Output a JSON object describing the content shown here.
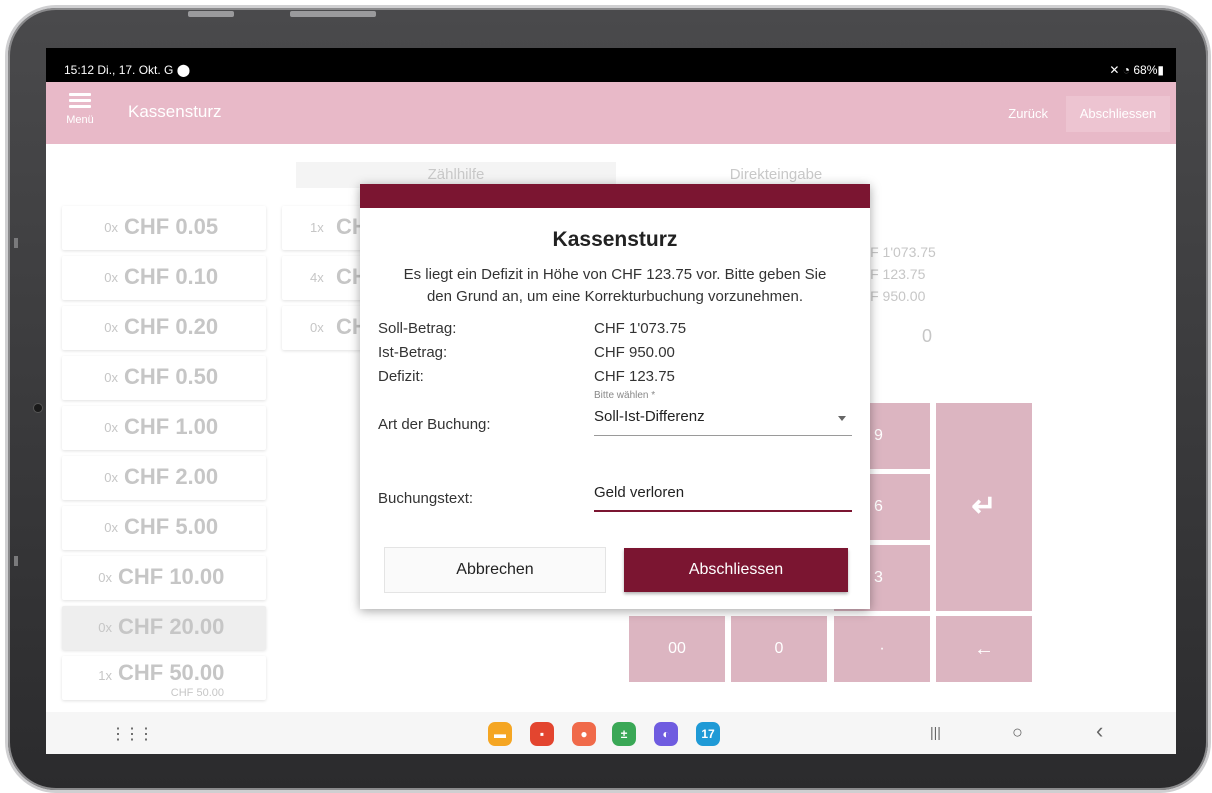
{
  "status_bar": {
    "time": "15:12  Di., 17. Okt.  G ⬤",
    "right": "✕ ◔ 68%▮"
  },
  "app_bar": {
    "menu_label": "Menü",
    "title": "Kassensturz",
    "back_label": "Zurück",
    "close_label": "Abschliessen",
    "color": "#e8b9c8"
  },
  "tabs": [
    {
      "label": "Zählhilfe"
    },
    {
      "label": "Direkteingabe"
    }
  ],
  "denominations": [
    {
      "count": "0x",
      "value": "CHF 0.05"
    },
    {
      "count": "0x",
      "value": "CHF 0.10"
    },
    {
      "count": "0x",
      "value": "CHF 0.20"
    },
    {
      "count": "0x",
      "value": "CHF 0.50"
    },
    {
      "count": "0x",
      "value": "CHF 1.00"
    },
    {
      "count": "0x",
      "value": "CHF 2.00"
    },
    {
      "count": "0x",
      "value": "CHF 5.00"
    },
    {
      "count": "0x",
      "value": "CHF 10.00"
    },
    {
      "count": "0x",
      "value": "CHF 20.00"
    },
    {
      "count": "1x",
      "value": "CHF 50.00",
      "subtotal": "CHF 50.00"
    }
  ],
  "denominations_col2": [
    {
      "count": "1x",
      "value": "CH"
    },
    {
      "count": "4x",
      "value": "CH"
    },
    {
      "count": "0x",
      "value": "CHI"
    }
  ],
  "summary": {
    "target": "HF 1'073.75",
    "deficit": "HF 123.75",
    "actual": "HF 950.00",
    "zero": "0"
  },
  "keypad": {
    "k9": "9",
    "k6": "6",
    "k3": "3",
    "k00": "00",
    "k0": "0",
    "kdot": "·",
    "enter": "↵",
    "backspace": "←"
  },
  "dialog": {
    "header_color": "#7b1531",
    "title": "Kassensturz",
    "message": "Es liegt ein Defizit in Höhe von CHF 123.75 vor. Bitte geben Sie den Grund an, um eine Korrekturbuchung vorzunehmen.",
    "soll_label": "Soll-Betrag:",
    "soll_value": "CHF 1'073.75",
    "ist_label": "Ist-Betrag:",
    "ist_value": "CHF 950.00",
    "defizit_label": "Defizit:",
    "defizit_value": "CHF 123.75",
    "booking_type_label": "Art der Buchung:",
    "booking_type_hint": "Bitte wählen *",
    "booking_type_value": "Soll-Ist-Differenz",
    "booking_text_label": "Buchungstext:",
    "booking_text_value": "Geld verloren",
    "cancel_label": "Abbrechen",
    "confirm_label": "Abschliessen"
  },
  "nav_bar": {
    "apps_icon": "apps-grid-icon",
    "dock": [
      "folder-icon",
      "notes-icon",
      "contacts-icon",
      "calculator-icon",
      "browser-icon",
      "calendar-icon"
    ],
    "calendar_day": "17",
    "recents": "|||",
    "home": "○",
    "back": "‹"
  }
}
